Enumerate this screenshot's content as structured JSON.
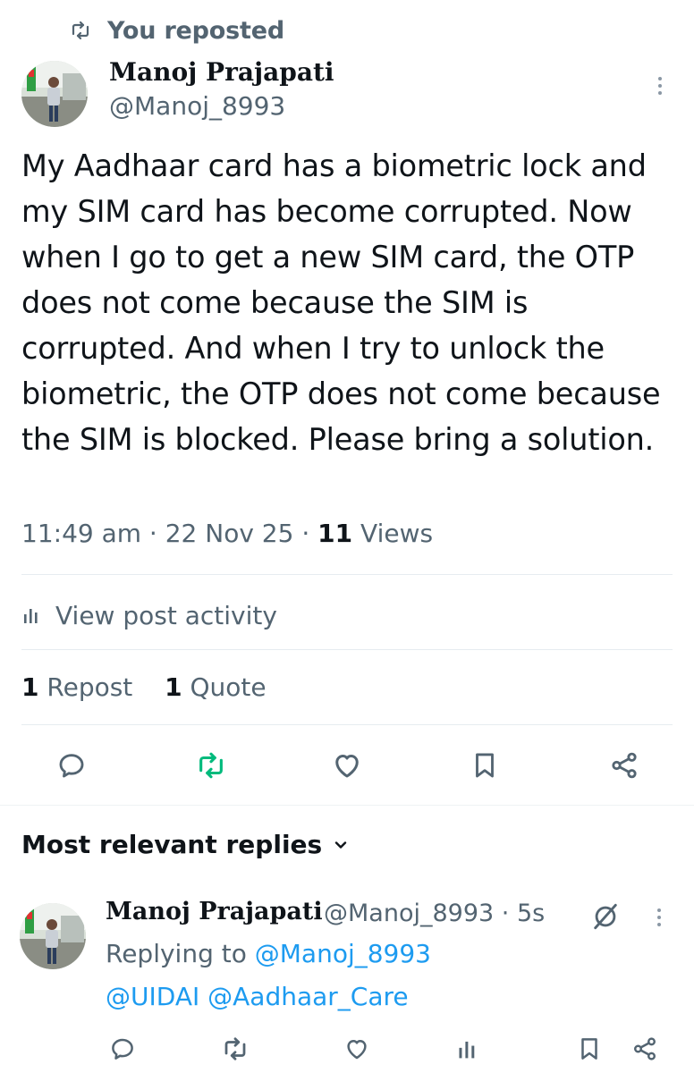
{
  "repost_banner": {
    "label": "You reposted"
  },
  "post": {
    "author_name": "Manoj Prajapati",
    "author_handle": "@Manoj_8993",
    "text": "My Aadhaar card has a biometric lock and my SIM card has become corrupted. Now when I go to get a new SIM card, the OTP does not come because the SIM is corrupted. And when I try to unlock the biometric, the OTP does not come because the SIM is blocked. Please bring a solution.",
    "time": "11:49 am",
    "date": "22 Nov 25",
    "views_count": "11",
    "views_label": "Views",
    "activity_label": "View post activity",
    "reposts_count": "1",
    "reposts_label": "Repost",
    "quotes_count": "1",
    "quotes_label": "Quote"
  },
  "actions": [
    "reply-icon",
    "repost-icon",
    "like-icon",
    "bookmark-icon",
    "share-icon"
  ],
  "replies_section": {
    "heading": "Most relevant replies"
  },
  "reply": {
    "author_name": "Manoj Prajapati",
    "author_handle": "@Manoj_8993",
    "time": "5s",
    "replying_to_label": "Replying to",
    "replying_to_handle": "@Manoj_8993",
    "mention_1": "@UIDAI",
    "mention_2": "@Aadhaar_Care"
  },
  "colors": {
    "text": "#0f1419",
    "secondary": "#536471",
    "link": "#1d9bf0",
    "repost_active": "#00ba7c",
    "divider": "#e6ecf0"
  }
}
